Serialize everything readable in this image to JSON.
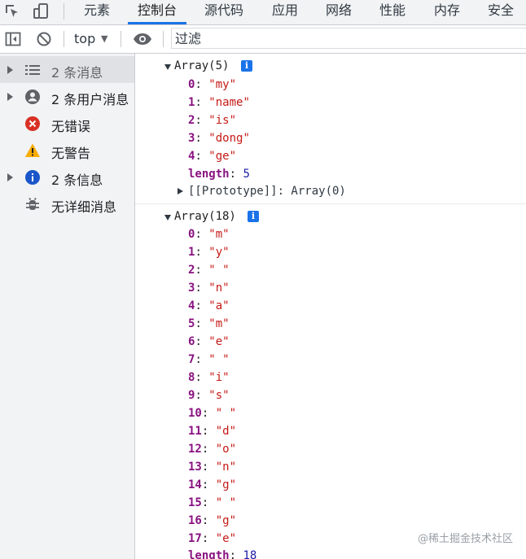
{
  "tabs": [
    {
      "id": "elements",
      "label": "元素",
      "active": false
    },
    {
      "id": "console",
      "label": "控制台",
      "active": true
    },
    {
      "id": "sources",
      "label": "源代码",
      "active": false
    },
    {
      "id": "application",
      "label": "应用",
      "active": false
    },
    {
      "id": "network",
      "label": "网络",
      "active": false
    },
    {
      "id": "performance",
      "label": "性能",
      "active": false
    },
    {
      "id": "memory",
      "label": "内存",
      "active": false
    },
    {
      "id": "security",
      "label": "安全",
      "active": false
    }
  ],
  "toolbar": {
    "context": "top",
    "filter_placeholder": "过滤"
  },
  "sidebar": {
    "items": [
      {
        "label": "2 条消息",
        "icon": "list-icon",
        "expandable": true,
        "selected": true
      },
      {
        "label": "2 条用户消息",
        "icon": "user-icon",
        "expandable": true,
        "selected": false
      },
      {
        "label": "无错误",
        "icon": "error-icon",
        "expandable": false,
        "selected": false
      },
      {
        "label": "无警告",
        "icon": "warning-icon",
        "expandable": false,
        "selected": false
      },
      {
        "label": "2 条信息",
        "icon": "info-icon",
        "expandable": true,
        "selected": false
      },
      {
        "label": "无详细消息",
        "icon": "bug-icon",
        "expandable": false,
        "selected": false
      }
    ]
  },
  "console": {
    "arrays": [
      {
        "header": "Array(5)",
        "items": [
          {
            "key": "0",
            "value": "\"my\""
          },
          {
            "key": "1",
            "value": "\"name\""
          },
          {
            "key": "2",
            "value": "\"is\""
          },
          {
            "key": "3",
            "value": "\"dong\""
          },
          {
            "key": "4",
            "value": "\"ge\""
          }
        ],
        "length_key": "length",
        "length_value": "5",
        "prototype": "[[Prototype]]: Array(0)"
      },
      {
        "header": "Array(18)",
        "items": [
          {
            "key": "0",
            "value": "\"m\""
          },
          {
            "key": "1",
            "value": "\"y\""
          },
          {
            "key": "2",
            "value": "\" \""
          },
          {
            "key": "3",
            "value": "\"n\""
          },
          {
            "key": "4",
            "value": "\"a\""
          },
          {
            "key": "5",
            "value": "\"m\""
          },
          {
            "key": "6",
            "value": "\"e\""
          },
          {
            "key": "7",
            "value": "\" \""
          },
          {
            "key": "8",
            "value": "\"i\""
          },
          {
            "key": "9",
            "value": "\"s\""
          },
          {
            "key": "10",
            "value": "\" \""
          },
          {
            "key": "11",
            "value": "\"d\""
          },
          {
            "key": "12",
            "value": "\"o\""
          },
          {
            "key": "13",
            "value": "\"n\""
          },
          {
            "key": "14",
            "value": "\"g\""
          },
          {
            "key": "15",
            "value": "\" \""
          },
          {
            "key": "16",
            "value": "\"g\""
          },
          {
            "key": "17",
            "value": "\"e\""
          }
        ],
        "length_key": "length",
        "length_value": "18"
      }
    ]
  },
  "watermark": "@稀土掘金技术社区",
  "colors": {
    "accent": "#1a73e8",
    "key": "#881280",
    "string": "#c41a16",
    "number": "#1a1aa6",
    "error": "#d93025",
    "warning": "#f9ab00"
  }
}
